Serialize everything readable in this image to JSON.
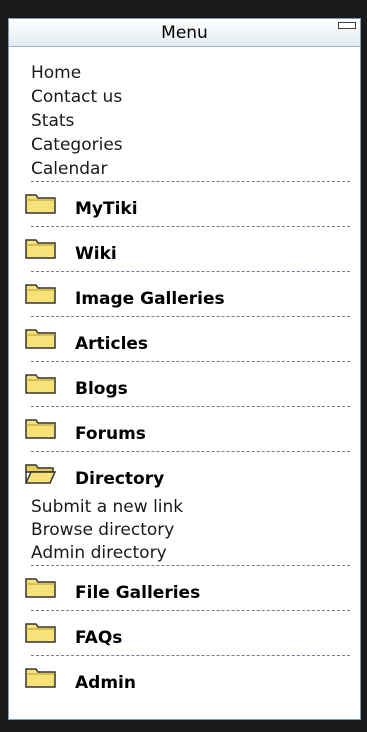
{
  "menu": {
    "title": "Menu",
    "top_links": [
      "Home",
      "Contact us",
      "Stats",
      "Categories",
      "Calendar"
    ],
    "sections": [
      {
        "label": "MyTiki",
        "icon": "folder-closed-icon"
      },
      {
        "label": "Wiki",
        "icon": "folder-closed-icon"
      },
      {
        "label": "Image Galleries",
        "icon": "folder-closed-icon"
      },
      {
        "label": "Articles",
        "icon": "folder-closed-icon"
      },
      {
        "label": "Blogs",
        "icon": "folder-closed-icon"
      },
      {
        "label": "Forums",
        "icon": "folder-closed-icon"
      },
      {
        "label": "Directory",
        "icon": "folder-open-icon",
        "expanded": true,
        "sub_links": [
          "Submit a new link",
          "Browse directory",
          "Admin directory"
        ]
      },
      {
        "label": "File Galleries",
        "icon": "folder-closed-icon"
      },
      {
        "label": "FAQs",
        "icon": "folder-closed-icon"
      },
      {
        "label": "Admin",
        "icon": "folder-closed-icon"
      }
    ]
  },
  "colors": {
    "background": "#1a1a1a",
    "panel_border": "#7f9db9",
    "folder_fill": "#f7e27a",
    "folder_outline": "#333333",
    "separator": "#6f7f96"
  }
}
